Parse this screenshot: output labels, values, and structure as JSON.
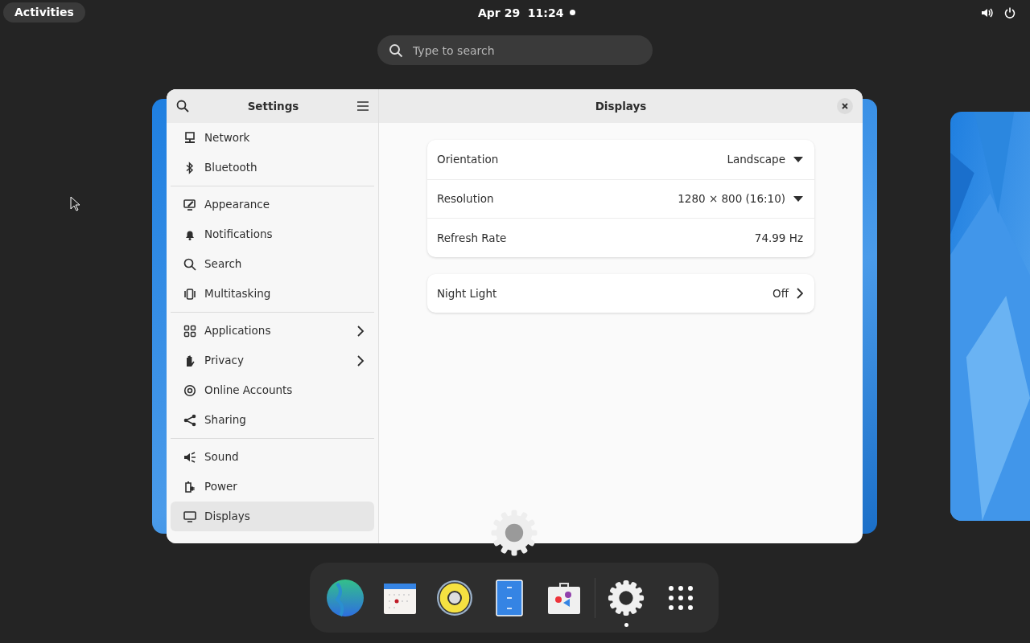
{
  "top_bar": {
    "activities": "Activities",
    "clock": "Apr 29  11:24"
  },
  "search": {
    "placeholder": "Type to search"
  },
  "window": {
    "sidebar_title": "Settings",
    "title": "Displays"
  },
  "sidebar": {
    "groups": [
      [
        {
          "label": "Network",
          "selected": false,
          "submenu": false
        },
        {
          "label": "Bluetooth",
          "selected": false,
          "submenu": false
        }
      ],
      [
        {
          "label": "Appearance",
          "selected": false,
          "submenu": false
        },
        {
          "label": "Notifications",
          "selected": false,
          "submenu": false
        },
        {
          "label": "Search",
          "selected": false,
          "submenu": false
        },
        {
          "label": "Multitasking",
          "selected": false,
          "submenu": false
        }
      ],
      [
        {
          "label": "Applications",
          "selected": false,
          "submenu": true
        },
        {
          "label": "Privacy",
          "selected": false,
          "submenu": true
        },
        {
          "label": "Online Accounts",
          "selected": false,
          "submenu": false
        },
        {
          "label": "Sharing",
          "selected": false,
          "submenu": false
        }
      ],
      [
        {
          "label": "Sound",
          "selected": false,
          "submenu": false
        },
        {
          "label": "Power",
          "selected": false,
          "submenu": false
        },
        {
          "label": "Displays",
          "selected": true,
          "submenu": false
        }
      ]
    ]
  },
  "settings_groups": [
    [
      {
        "label": "Orientation",
        "value": "Landscape",
        "kind": "dropdown"
      },
      {
        "label": "Resolution",
        "value": "1280 × 800 (16:10)",
        "kind": "dropdown"
      },
      {
        "label": "Refresh Rate",
        "value": "74.99 Hz",
        "kind": "plain"
      }
    ],
    [
      {
        "label": "Night Light",
        "value": "Off",
        "kind": "link"
      }
    ]
  ],
  "dock": [
    {
      "running": false
    },
    {
      "running": false
    },
    {
      "running": false
    },
    {
      "running": false
    },
    {
      "running": false
    },
    {
      "running": true
    }
  ]
}
